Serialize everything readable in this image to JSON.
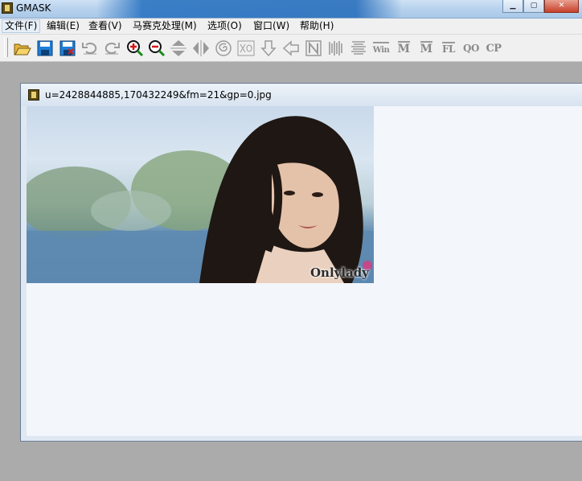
{
  "window": {
    "title": "GMASK",
    "buttons": [
      "minimize",
      "maximize",
      "close"
    ]
  },
  "menu": [
    {
      "label": "文件(F)"
    },
    {
      "label": "编辑(E)"
    },
    {
      "label": "查看(V)"
    },
    {
      "label": "马赛克处理(M)"
    },
    {
      "label": "选项(O)"
    },
    {
      "label": "窗口(W)"
    },
    {
      "label": "帮助(H)"
    }
  ],
  "toolbar": {
    "text_buttons": {
      "win": "Win",
      "m1": "M",
      "m2": "M",
      "fl": "FL",
      "qo": "QO",
      "cp": "CP"
    }
  },
  "document": {
    "title": "u=2428844885,170432249&fm=21&gp=0.jpg",
    "watermark": "Onlylady"
  }
}
